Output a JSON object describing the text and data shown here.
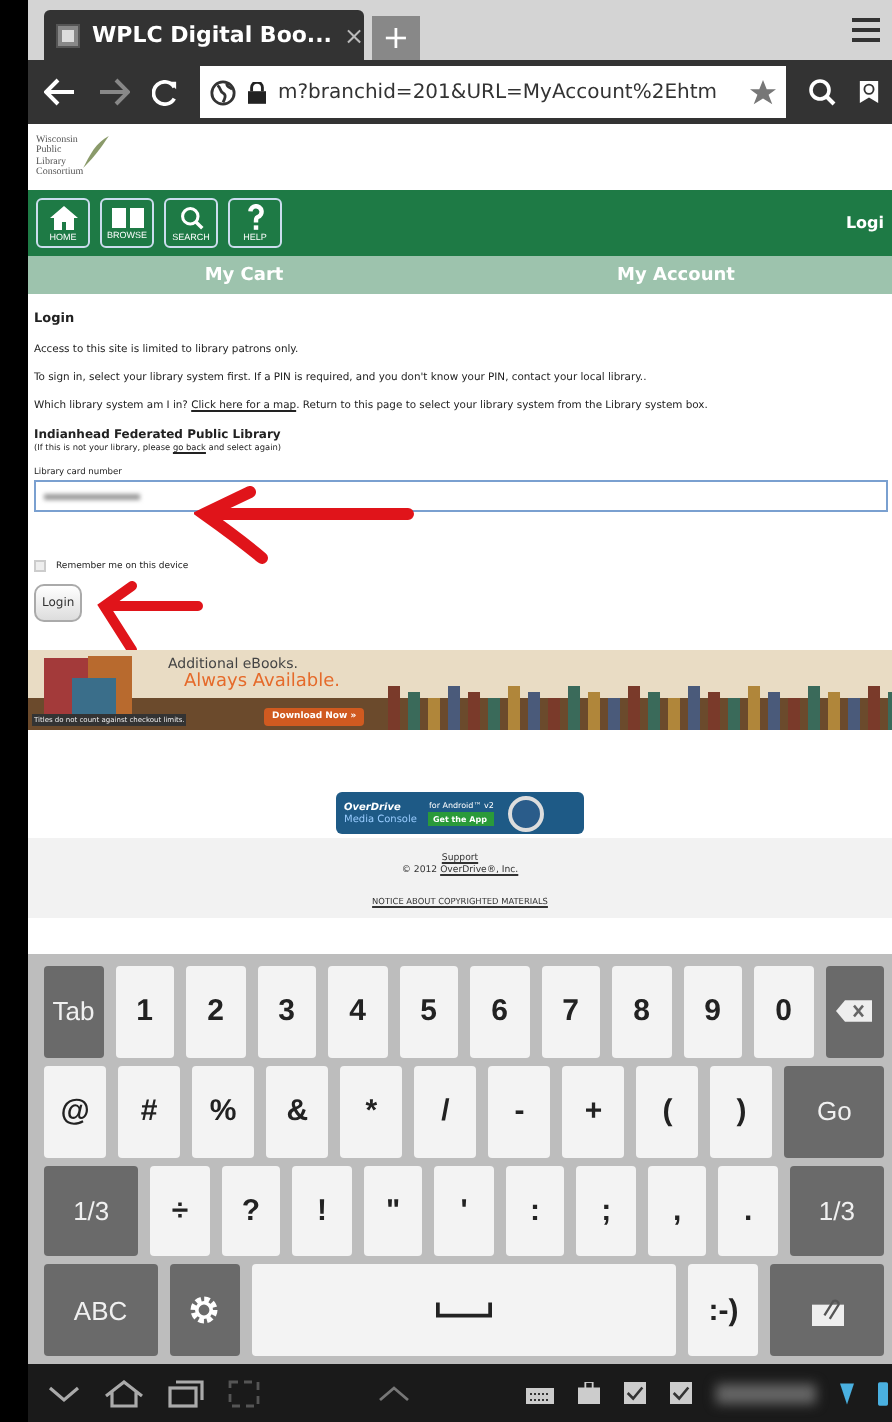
{
  "browser": {
    "tab_title": "WPLC Digital Boo...",
    "tab_close": "×",
    "new_tab": "+",
    "url": "m?branchid=201&URL=MyAccount%2Ehtm"
  },
  "logo": {
    "lines": [
      "Wisconsin",
      "Public",
      "Library",
      "Consortium"
    ]
  },
  "nav": {
    "buttons": [
      {
        "label": "HOME",
        "kind": "home"
      },
      {
        "label": "BROWSE",
        "kind": "browse"
      },
      {
        "label": "SEARCH",
        "kind": "search"
      },
      {
        "label": "HELP",
        "kind": "help"
      }
    ],
    "login": "Logi"
  },
  "subnav": [
    "My Cart",
    "My Account"
  ],
  "login": {
    "heading": "Login",
    "para1": "Access to this site is limited to library patrons only.",
    "para2": "To sign in, select your library system first. If a PIN is required, and you don't know your PIN, contact your local library..",
    "para3_before": "Which library system am I in?",
    "para3_link": "Click here for a map",
    "para3_after": ". Return to this page to select your library system from the Library system box.",
    "library": "Indianhead Federated Public Library",
    "note_before": "(If this is not your library, please",
    "note_link": "go back",
    "note_after": "and select again)",
    "field_label": "Library card number",
    "remember": "Remember me on this device",
    "remember_checked": false,
    "button": "Login"
  },
  "banner": {
    "line1": "Additional eBooks.",
    "line2": "Always Available.",
    "button": "Download Now »",
    "caption": "Titles do not count against checkout limits."
  },
  "app_badge": {
    "brand": "OverDrive",
    "product": "Media Console",
    "platform": "for Android™ v2",
    "button": "Get the App"
  },
  "footer": {
    "support": "Support",
    "copyright": "© 2012",
    "company": "OverDrive®, Inc.",
    "notice": "NOTICE ABOUT COPYRIGHTED MATERIALS"
  },
  "keyboard": {
    "rows": [
      [
        {
          "label": "Tab",
          "kind": "mod"
        },
        {
          "label": "1",
          "kind": "char"
        },
        {
          "label": "2",
          "kind": "char"
        },
        {
          "label": "3",
          "kind": "char"
        },
        {
          "label": "4",
          "kind": "char"
        },
        {
          "label": "5",
          "kind": "char"
        },
        {
          "label": "6",
          "kind": "char"
        },
        {
          "label": "7",
          "kind": "char"
        },
        {
          "label": "8",
          "kind": "char"
        },
        {
          "label": "9",
          "kind": "char"
        },
        {
          "label": "0",
          "kind": "char"
        },
        {
          "kind": "backspace"
        }
      ],
      [
        {
          "label": "@",
          "kind": "char"
        },
        {
          "label": "#",
          "kind": "char"
        },
        {
          "label": "%",
          "kind": "char"
        },
        {
          "label": "&",
          "kind": "char"
        },
        {
          "label": "*",
          "kind": "char"
        },
        {
          "label": "/",
          "kind": "char"
        },
        {
          "label": "-",
          "kind": "char"
        },
        {
          "label": "+",
          "kind": "char"
        },
        {
          "label": "(",
          "kind": "char"
        },
        {
          "label": ")",
          "kind": "char"
        },
        {
          "label": "Go",
          "kind": "wide-mod"
        }
      ],
      [
        {
          "label": "1/3",
          "kind": "wide-mod"
        },
        {
          "label": "÷",
          "kind": "char"
        },
        {
          "label": "?",
          "kind": "char"
        },
        {
          "label": "!",
          "kind": "char"
        },
        {
          "label": "\"",
          "kind": "char"
        },
        {
          "label": "'",
          "kind": "char"
        },
        {
          "label": ":",
          "kind": "char"
        },
        {
          "label": ";",
          "kind": "char"
        },
        {
          "label": ",",
          "kind": "char"
        },
        {
          "label": ".",
          "kind": "char"
        },
        {
          "label": "1/3",
          "kind": "wide-mod"
        }
      ],
      [
        {
          "label": "ABC",
          "kind": "wide-mod"
        },
        {
          "kind": "settings"
        },
        {
          "kind": "space"
        },
        {
          "label": ":-)",
          "kind": "char"
        },
        {
          "kind": "clipboard"
        }
      ]
    ]
  }
}
